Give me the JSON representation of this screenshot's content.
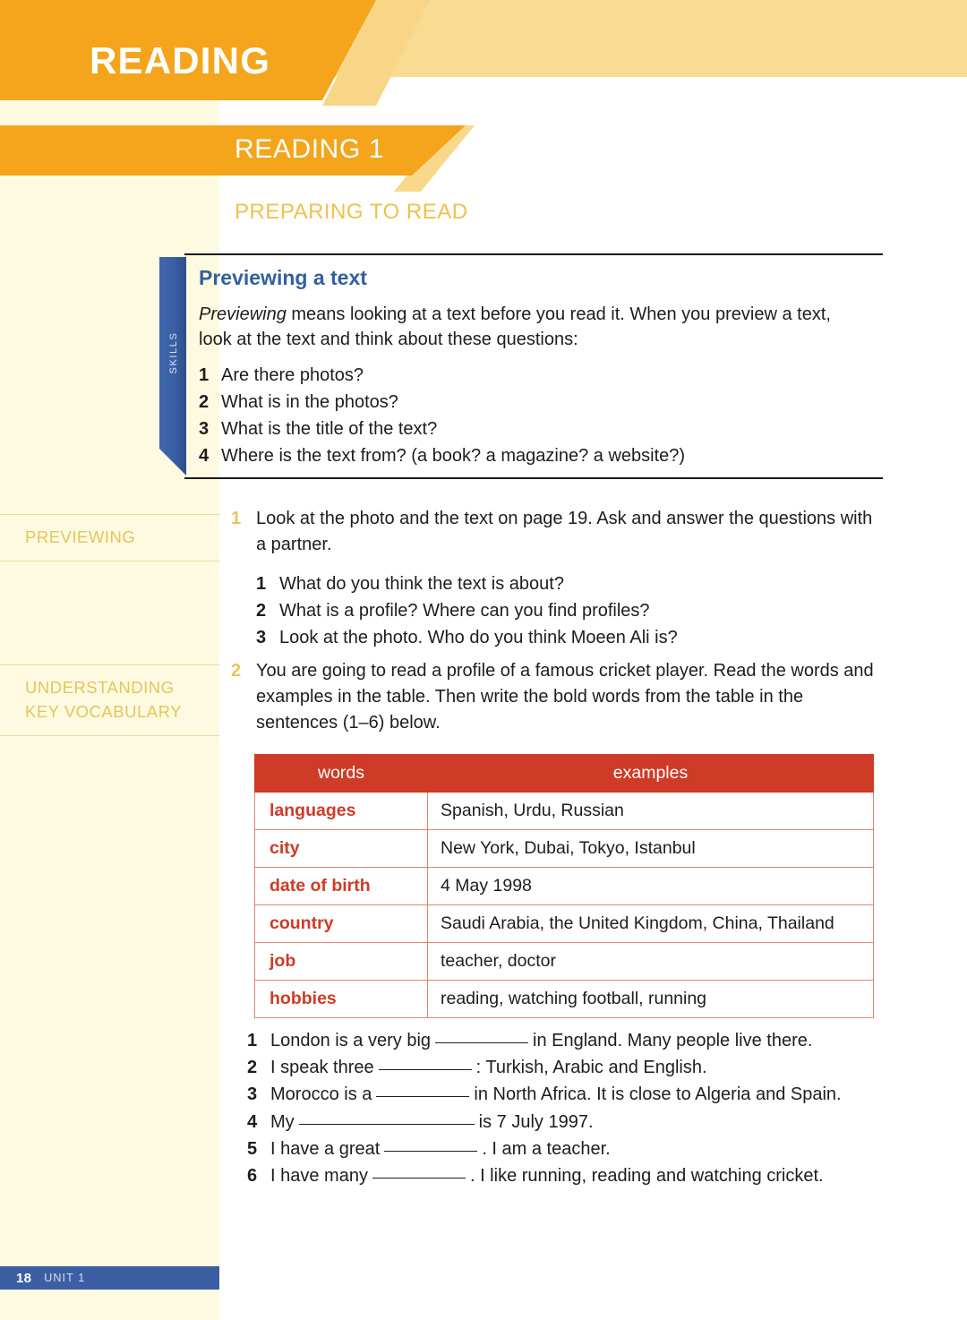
{
  "header": {
    "main_title": "READING",
    "banner_title": "READING 1",
    "subsection": "PREPARING TO READ"
  },
  "skills_box": {
    "tab_label": "SKILLS",
    "heading": "Previewing a text",
    "intro_italic": "Previewing",
    "intro_rest": " means looking at a text before you read it. When you preview a text, look at the text and think about these questions:",
    "questions": [
      {
        "num": "1",
        "text": "Are there photos?"
      },
      {
        "num": "2",
        "text": "What is in the photos?"
      },
      {
        "num": "3",
        "text": "What is the title of the text?"
      },
      {
        "num": "4",
        "text": "Where is the text from? (a book? a magazine? a website?)"
      }
    ]
  },
  "margin_labels": {
    "previewing": "PREVIEWING",
    "vocabulary_line1": "UNDERSTANDING",
    "vocabulary_line2": "KEY VOCABULARY"
  },
  "exercises": [
    {
      "num": "1",
      "instruction": "Look at the photo and the text on page 19. Ask and answer the questions with a partner.",
      "sub_questions": [
        {
          "num": "1",
          "text": "What do you think the text is about?"
        },
        {
          "num": "2",
          "text": "What is a profile? Where can you find profiles?"
        },
        {
          "num": "3",
          "text": "Look at the photo. Who do you think Moeen Ali is?"
        }
      ]
    },
    {
      "num": "2",
      "instruction": "You are going to read a profile of a famous cricket player. Read the words and examples in the table. Then write the bold words from the table in the sentences (1–6) below."
    }
  ],
  "table": {
    "headers": [
      "words",
      "examples"
    ],
    "rows": [
      {
        "word": "languages",
        "examples": "Spanish, Urdu, Russian"
      },
      {
        "word": "city",
        "examples": "New York, Dubai, Tokyo, Istanbul"
      },
      {
        "word": "date of birth",
        "examples": "4 May 1998"
      },
      {
        "word": "country",
        "examples": "Saudi Arabia, the United Kingdom, China, Thailand"
      },
      {
        "word": "job",
        "examples": "teacher, doctor"
      },
      {
        "word": "hobbies",
        "examples": "reading, watching football, running"
      }
    ]
  },
  "gap_fill_sentences": [
    {
      "num": "1",
      "before": "London is a very big",
      "blank": "short",
      "after": "in England. Many people live there."
    },
    {
      "num": "2",
      "before": "I speak three",
      "blank": "short",
      "after": ": Turkish, Arabic and English."
    },
    {
      "num": "3",
      "before": "Morocco is a",
      "blank": "short",
      "after": "in North Africa. It is close to Algeria and Spain."
    },
    {
      "num": "4",
      "before": "My",
      "blank": "long",
      "after": "is 7 July 1997."
    },
    {
      "num": "5",
      "before": "I have a great",
      "blank": "short",
      "after": ". I am a teacher."
    },
    {
      "num": "6",
      "before": "I have many",
      "blank": "short",
      "after": ". I like running, reading and watching cricket."
    }
  ],
  "footer": {
    "page_number": "18",
    "unit_label": "UNIT 1"
  },
  "colors": {
    "header_orange": "#F4A51C",
    "header_tan": "#F9DC92",
    "sidebar_cream": "#FDFAE1",
    "table_red": "#CE3B27",
    "skills_blue": "#33609E",
    "footer_blue": "#3C5FA3",
    "margin_label_gold": "#E5C45C"
  }
}
